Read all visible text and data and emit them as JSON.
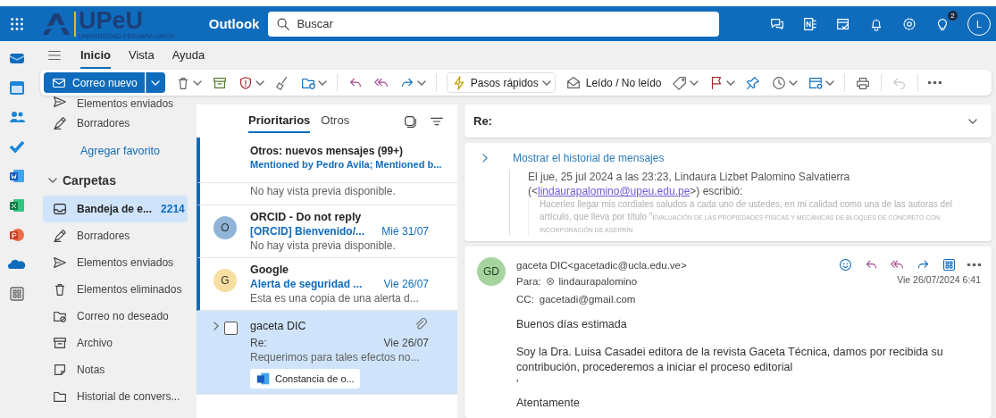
{
  "header": {
    "logo_text": "UPeU",
    "logo_subtitle": "UNIVERSIDAD PERUANA UNION",
    "app_name": "Outlook",
    "search": {
      "placeholder": "Buscar"
    },
    "tips_badge": "2",
    "avatar_initial": "L"
  },
  "ribbon_tabs": [
    {
      "label": "Inicio",
      "selected": true
    },
    {
      "label": "Vista",
      "selected": false
    },
    {
      "label": "Ayuda",
      "selected": false
    }
  ],
  "toolbar": {
    "new_mail": "Correo nuevo",
    "quick_steps": "Pasos rápidos",
    "read_unread": "Leído / No leído",
    "undo_disabled": true
  },
  "folders": {
    "favorites": [
      {
        "label": "Elementos enviados",
        "kind": "sent",
        "selected": false
      },
      {
        "label": "Borradores",
        "kind": "drafts",
        "selected": false
      }
    ],
    "add_favorite": "Agregar favorito",
    "section": {
      "label": "Carpetas",
      "expanded": true
    },
    "items": [
      {
        "label": "Bandeja de e...",
        "count": "2214",
        "kind": "inbox",
        "selected": true
      },
      {
        "label": "Borradores",
        "kind": "drafts",
        "selected": false
      },
      {
        "label": "Elementos enviados",
        "kind": "sent",
        "selected": false
      },
      {
        "label": "Elementos eliminados",
        "kind": "trash",
        "selected": false
      },
      {
        "label": "Correo no deseado",
        "kind": "junk",
        "selected": false
      },
      {
        "label": "Archivo",
        "kind": "archive",
        "selected": false
      },
      {
        "label": "Notas",
        "kind": "notes",
        "selected": false
      },
      {
        "label": "Historial de convers...",
        "kind": "history",
        "selected": false
      }
    ]
  },
  "message_list": {
    "tabs": [
      {
        "label": "Prioritarios",
        "selected": true
      },
      {
        "label": "Otros",
        "selected": false
      }
    ],
    "messages": [
      {
        "kind": "notice",
        "title": "Otros: nuevos mensajes (99+)",
        "preview": "Mentioned by Pedro Avila; Mentioned b...",
        "unread": true,
        "selected": false
      },
      {
        "kind": "partial",
        "preview": "No hay vista previa disponible.",
        "unread": true,
        "selected": false
      },
      {
        "kind": "mail",
        "avatar": "O",
        "color": "#8fb4d8",
        "sender": "ORCID - Do not reply",
        "subject": "[ORCID] Bienvenido/...",
        "date": "Mié 31/07",
        "preview": "No hay vista previa disponible.",
        "unread": true,
        "selected": false
      },
      {
        "kind": "mail",
        "avatar": "G",
        "color": "#f6dfa0",
        "sender": "Google",
        "subject": "Alerta de seguridad ...",
        "date": "Vie 26/07",
        "preview": "Esta es una copia de una alerta d...",
        "unread": true,
        "selected": false
      },
      {
        "kind": "mail",
        "sender": "gaceta DIC",
        "subject": "Re:",
        "date": "Vie 26/07",
        "preview": "Requerimos para tales efectos no...",
        "attachment": "Constancia de o...",
        "has_attachment": true,
        "unread": false,
        "selected": true,
        "checked": false
      }
    ]
  },
  "reading_pane": {
    "subject": "Re:",
    "history": {
      "toggle": "Mostrar el historial de mensajes",
      "header_line1": "El jue, 25 jul 2024 a las 23:23, Lindaura Lizbet Palomino Salvatierra",
      "header_before": "(<",
      "link": "lindaurapalomino@upeu.edu.pe",
      "header_after": ">) escribió:",
      "quote": "Hacerles llegar mis cordiales saludos a cada uno de ustedes, en mi calidad como una de las autoras del artículo,",
      "quote_start": "que lleva por título \"",
      "quote_title": "EVALUACIÓN DE LAS PROPIEDADES FÍSICAS Y MECÁNICAS DE BLOQUES DE CONCRETO CON INCORPORACIÓN DE ASERRÍN"
    },
    "message": {
      "avatar": "GD",
      "from": "gaceta DIC<gacetadic@ucla.edu.ve>",
      "to_label": "Para:",
      "to": "lindaurapalomino",
      "date": "Vie 26/07/2024 6:41",
      "cc_label": "CC:",
      "cc": "gacetadi@gmail.com",
      "body": [
        "Buenos días estimada",
        "Soy la Dra. Luisa Casadei editora de la revista Gaceta Técnica, damos por recibida su contribución, procederemos a iniciar el proceso editorial",
        "'",
        "Atentamente"
      ]
    }
  }
}
